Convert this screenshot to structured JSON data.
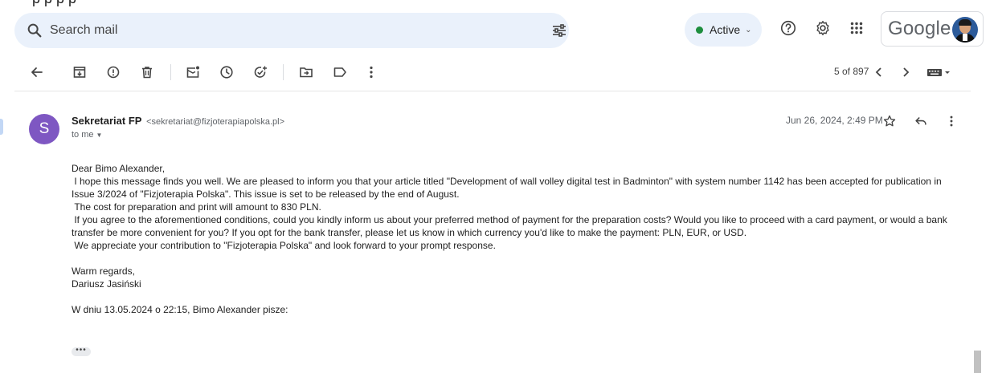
{
  "clipped_top_text": "p p p p",
  "search": {
    "placeholder": "Search mail",
    "icon": "search-icon"
  },
  "status": {
    "label": "Active",
    "color": "#1e8e3e"
  },
  "brand": {
    "logo_text": "Google"
  },
  "pager": {
    "label": "5 of 897"
  },
  "message": {
    "sender_initial": "S",
    "sender_name": "Sekretariat FP",
    "sender_email": "<sekretariat@fizjoterapiapolska.pl>",
    "recipient": "to me",
    "date": "Jun 26, 2024, 2:49 PM",
    "avatar_color": "#7e57c2",
    "body": {
      "greeting": "Dear Bimo Alexander,",
      "para1": " I hope this message finds you well. We are pleased to inform you that your article titled \"Development of wall volley digital test in Badminton\" with system number 1142 has been accepted for publication in Issue 3/2024 of \"Fizjoterapia Polska\". This issue is set to be released by the end of August.",
      "para2": " The cost for preparation and print will amount to 830 PLN.",
      "para3": " If you agree to the aforementioned conditions, could you kindly inform us about your preferred method of payment for the preparation costs? Would you like to proceed with a card payment, or would a bank transfer be more convenient for you? If you opt for the bank transfer, please let us know in which currency you'd like to make the payment: PLN, EUR, or USD.",
      "para4": " We appreciate your contribution to \"Fizjoterapia Polska\" and look forward to your prompt response.",
      "closing": "Warm regards,",
      "signature": "Dariusz Jasiński",
      "quote_header": "W dniu 13.05.2024 o 22:15, Bimo Alexander pisze:",
      "ellipsis": "•••"
    }
  }
}
